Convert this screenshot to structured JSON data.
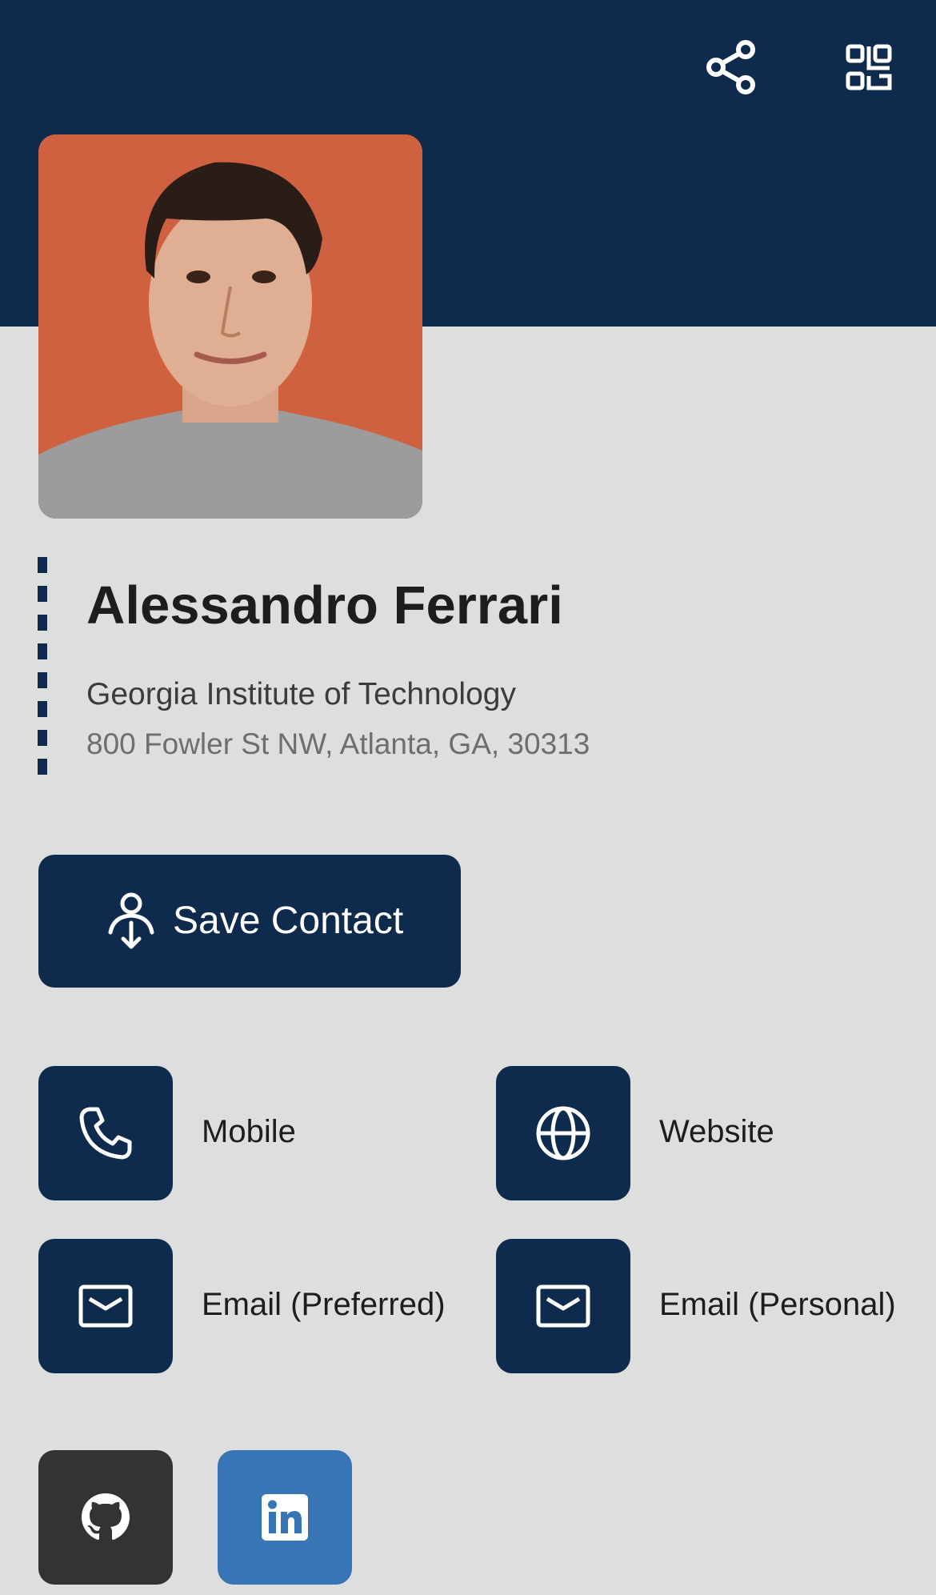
{
  "header": {
    "share_icon": "share-icon",
    "qr_icon": "qr-code-icon",
    "background_color": "#0e2a4d"
  },
  "profile": {
    "name": "Alessandro Ferrari",
    "organization": "Georgia Institute of Technology",
    "address": "800 Fowler St NW, Atlanta, GA, 30313",
    "photo_background_color": "#cf6141"
  },
  "actions": {
    "save_contact_label": "Save Contact"
  },
  "contacts": [
    {
      "label": "Mobile",
      "icon": "phone-icon"
    },
    {
      "label": "Website",
      "icon": "globe-icon"
    },
    {
      "label": "Email (Preferred)",
      "icon": "mail-icon"
    },
    {
      "label": "Email (Personal)",
      "icon": "mail-icon"
    }
  ],
  "socials": [
    {
      "icon": "github-icon",
      "color": "#333333"
    },
    {
      "icon": "linkedin-icon",
      "color": "#3775b5"
    }
  ],
  "colors": {
    "primary": "#0e2a4d",
    "page_background": "#dfdedf"
  }
}
